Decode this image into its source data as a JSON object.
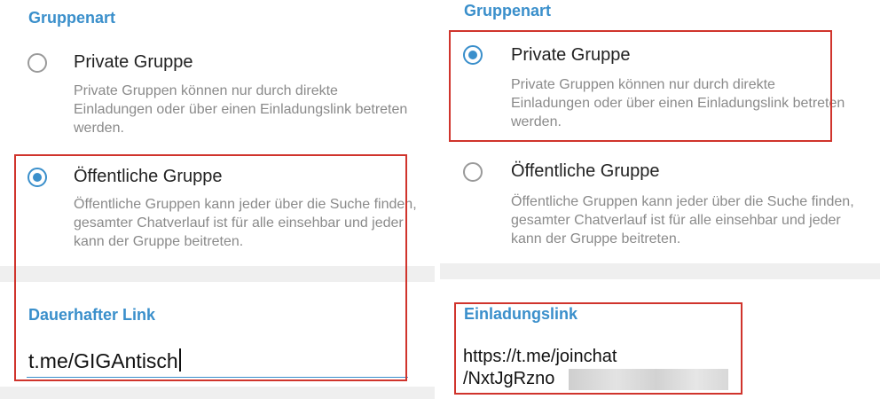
{
  "left": {
    "section_title": "Gruppenart",
    "options": [
      {
        "label": "Private Gruppe",
        "description": "Private Gruppen können nur durch direkte Einladungen oder über einen Einladungslink betreten werden.",
        "selected": false
      },
      {
        "label": "Öffentliche Gruppe",
        "description": "Öffentliche Gruppen kann jeder über die Suche finden, gesamter Chatverlauf ist für alle einsehbar und jeder kann der Gruppe beitreten.",
        "selected": true
      }
    ],
    "link_title": "Dauerhafter Link",
    "link_value": "t.me/GIGAntisch"
  },
  "right": {
    "section_title": "Gruppenart",
    "options": [
      {
        "label": "Private Gruppe",
        "description": "Private Gruppen können nur durch direkte Einladungen oder über einen Einladungslink betreten werden.",
        "selected": true
      },
      {
        "label": "Öffentliche Gruppe",
        "description": "Öffentliche Gruppen kann jeder über die Suche finden, gesamter Chatverlauf ist für alle einsehbar und jeder kann der Gruppe beitreten.",
        "selected": false
      }
    ],
    "link_title": "Einladungslink",
    "link_line1": "https://t.me/joinchat",
    "link_line2": "/NxtJgRzno"
  },
  "colors": {
    "accent": "#3a8fcb",
    "highlight_box": "#d0342c",
    "divider": "#efefef"
  }
}
